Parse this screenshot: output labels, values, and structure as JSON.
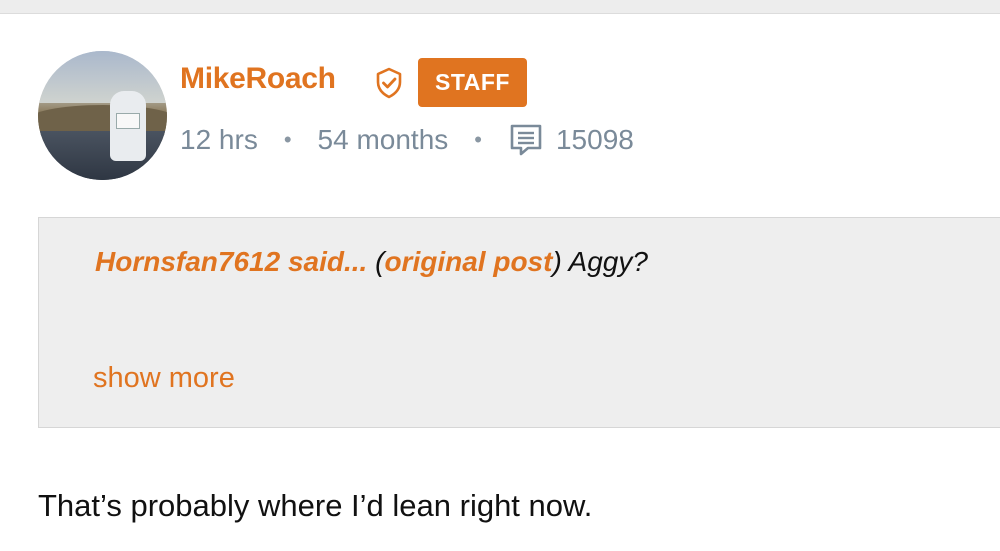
{
  "post": {
    "author": {
      "username": "MikeRoach",
      "badge": "STAFF",
      "verified_icon": "shield-check-icon",
      "avatar_icon": "user-avatar-photo"
    },
    "meta": {
      "time_ago": "12 hrs",
      "membership": "54 months",
      "comment_icon": "comment-icon",
      "post_count": "15098"
    },
    "quote": {
      "author_said": "Hornsfan7612 said...",
      "open_paren": "(",
      "original_post_label": "original post",
      "close_paren": ")",
      "text": " Aggy?",
      "show_more_label": "show more"
    },
    "body": "That’s probably where I’d lean right now."
  },
  "colors": {
    "accent": "#e07420",
    "meta_text": "#7a8a99",
    "quote_bg": "#eeeeee"
  }
}
